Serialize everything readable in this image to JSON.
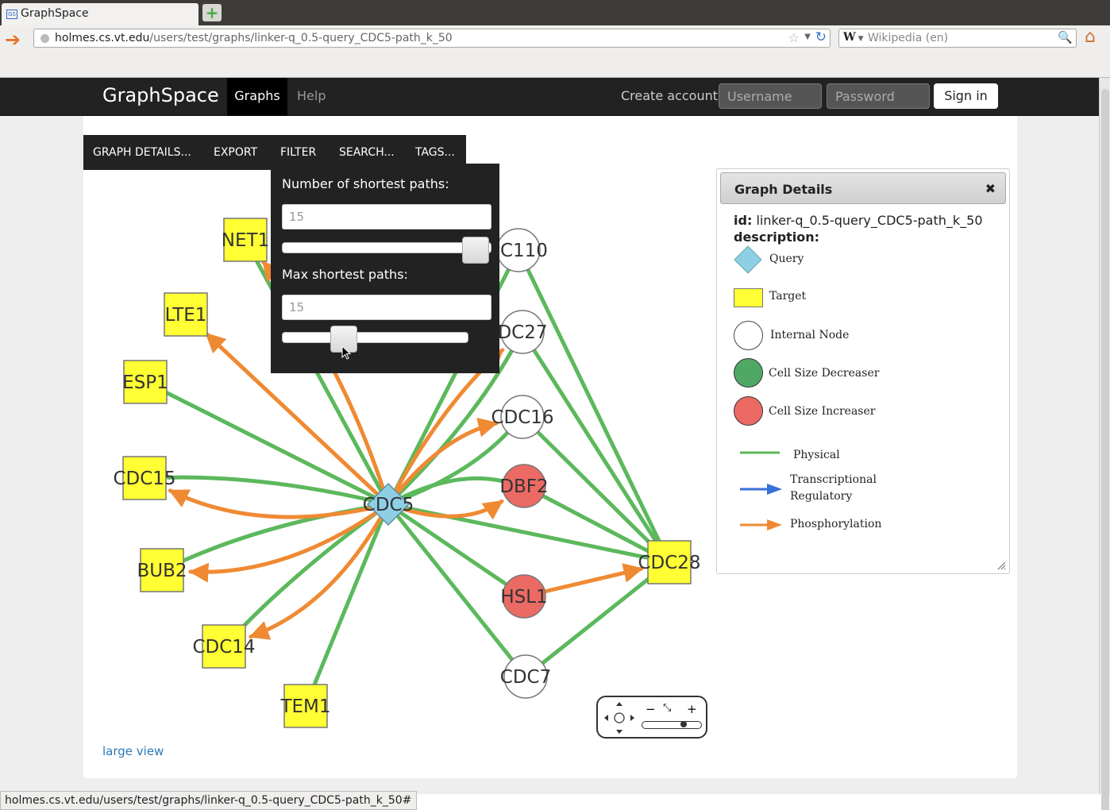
{
  "browser": {
    "tab_title": "GraphSpace",
    "favicon": "GS",
    "url_host": "holmes.cs.vt.edu",
    "url_path": "/users/test/graphs/linker-q_0.5-query_CDC5-path_k_50",
    "search_engine_icon": "W",
    "search_placeholder": "Wikipedia (en)",
    "status_url": "holmes.cs.vt.edu/users/test/graphs/linker-q_0.5-query_CDC5-path_k_50#"
  },
  "app": {
    "brand": "GraphSpace",
    "nav": {
      "graphs": "Graphs",
      "help": "Help"
    },
    "create_account": "Create account",
    "username_placeholder": "Username",
    "password_placeholder": "Password",
    "sign_in": "Sign in"
  },
  "toolbar": {
    "graph_details": "GRAPH DETAILS...",
    "export": "EXPORT",
    "filter": "FILTER",
    "search": "SEARCH...",
    "tags": "TAGS..."
  },
  "filter": {
    "num_paths_label": "Number of shortest paths:",
    "num_paths_value": "15",
    "num_paths_slider_fraction": 1.0,
    "max_paths_label": "Max shortest paths:",
    "max_paths_value": "15",
    "max_paths_slider_fraction": 0.3
  },
  "details": {
    "title": "Graph Details",
    "close": "✖",
    "id_label": "id:",
    "id_value": "linker-q_0.5-query_CDC5-path_k_50",
    "description_label": "description:",
    "legend": {
      "query": "Query",
      "target": "Target",
      "internal": "Internal Node",
      "decreaser": "Cell Size Decreaser",
      "increaser": "Cell Size Increaser",
      "physical": "Physical",
      "transcriptional_1": "Transcriptional",
      "transcriptional_2": "Regulatory",
      "phosphorylation": "Phosphorylation"
    }
  },
  "colors": {
    "physical": "#5cb85c",
    "phosphorylation": "#ef8a33",
    "transcriptional": "#3a6fd8",
    "query": "#8ecfe6",
    "target": "#ffff33",
    "decreaser": "#50a865",
    "increaser": "#ec6a64",
    "internal": "#ffffff"
  },
  "graph": {
    "nodes": [
      {
        "id": "CDC5",
        "label": "CDC5",
        "type": "query"
      },
      {
        "id": "NET1",
        "label": "NET1",
        "type": "target"
      },
      {
        "id": "LTE1",
        "label": "LTE1",
        "type": "target"
      },
      {
        "id": "ESP1",
        "label": "ESP1",
        "type": "target"
      },
      {
        "id": "CDC15",
        "label": "CDC15",
        "type": "target"
      },
      {
        "id": "BUB2",
        "label": "BUB2",
        "type": "target"
      },
      {
        "id": "CDC14",
        "label": "CDC14",
        "type": "target"
      },
      {
        "id": "TEM1",
        "label": "TEM1",
        "type": "target"
      },
      {
        "id": "CDC28",
        "label": "CDC28",
        "type": "target"
      },
      {
        "id": "PC110",
        "label": "PC110",
        "type": "internal"
      },
      {
        "id": "DC27",
        "label": "DC27",
        "type": "internal"
      },
      {
        "id": "CDC16",
        "label": "CDC16",
        "type": "internal"
      },
      {
        "id": "DBF2",
        "label": "DBF2",
        "type": "increaser"
      },
      {
        "id": "HSL1",
        "label": "HSL1",
        "type": "increaser"
      },
      {
        "id": "CDC7",
        "label": "CDC7",
        "type": "internal"
      }
    ],
    "edges": [
      {
        "from": "CDC5",
        "to": "NET1",
        "type": "physical"
      },
      {
        "from": "CDC5",
        "to": "ESP1",
        "type": "physical"
      },
      {
        "from": "CDC5",
        "to": "CDC15",
        "type": "physical"
      },
      {
        "from": "CDC5",
        "to": "BUB2",
        "type": "physical"
      },
      {
        "from": "CDC5",
        "to": "CDC14",
        "type": "physical"
      },
      {
        "from": "CDC5",
        "to": "TEM1",
        "type": "physical"
      },
      {
        "from": "CDC5",
        "to": "CDC28",
        "type": "physical"
      },
      {
        "from": "CDC5",
        "to": "DBF2",
        "type": "physical"
      },
      {
        "from": "CDC5",
        "to": "HSL1",
        "type": "physical"
      },
      {
        "from": "CDC5",
        "to": "CDC7",
        "type": "physical"
      },
      {
        "from": "CDC5",
        "to": "CDC16",
        "type": "physical"
      },
      {
        "from": "CDC5",
        "to": "DC27",
        "type": "physical"
      },
      {
        "from": "CDC5",
        "to": "PC110",
        "type": "physical"
      },
      {
        "from": "PC110",
        "to": "CDC28",
        "type": "physical"
      },
      {
        "from": "DC27",
        "to": "CDC28",
        "type": "physical"
      },
      {
        "from": "CDC16",
        "to": "CDC28",
        "type": "physical"
      },
      {
        "from": "DBF2",
        "to": "CDC28",
        "type": "physical"
      },
      {
        "from": "CDC7",
        "to": "CDC28",
        "type": "physical"
      },
      {
        "from": "CDC5",
        "to": "LTE1",
        "type": "phosphorylation"
      },
      {
        "from": "CDC5",
        "to": "CDC15",
        "type": "phosphorylation"
      },
      {
        "from": "CDC5",
        "to": "BUB2",
        "type": "phosphorylation"
      },
      {
        "from": "CDC5",
        "to": "CDC14",
        "type": "phosphorylation"
      },
      {
        "from": "CDC5",
        "to": "DBF2",
        "type": "phosphorylation"
      },
      {
        "from": "CDC5",
        "to": "CDC16",
        "type": "phosphorylation"
      },
      {
        "from": "CDC5",
        "to": "DC27",
        "type": "phosphorylation"
      },
      {
        "from": "CDC5",
        "to": "NET1",
        "type": "phosphorylation"
      },
      {
        "from": "HSL1",
        "to": "CDC28",
        "type": "phosphorylation"
      }
    ]
  },
  "large_view": "large view",
  "panzoom": {
    "minus": "−",
    "plus": "+"
  }
}
